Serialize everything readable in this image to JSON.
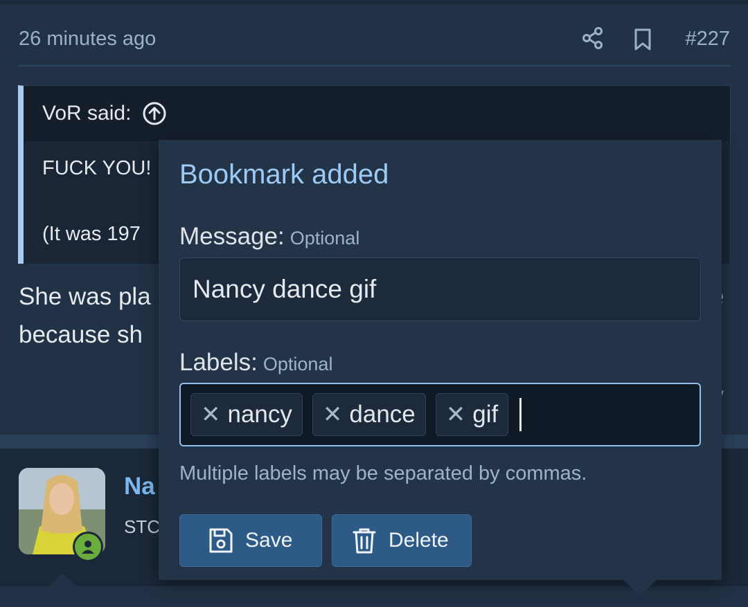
{
  "post": {
    "timestamp": "26 minutes ago",
    "post_number": "#227",
    "quote": {
      "author_line": "VoR said:",
      "line1": "FUCK YOU!",
      "line2": "(It was 197"
    },
    "body_line1": "She was pla",
    "body_line2": "because sh",
    "body_right1": "e",
    "body_right2": "y"
  },
  "next_post": {
    "username": "Na",
    "user_title": "STC"
  },
  "popup": {
    "title": "Bookmark added",
    "message_label": "Message:",
    "message_hint": "Optional",
    "message_value": "Nancy dance gif",
    "labels_label": "Labels:",
    "labels_hint": "Optional",
    "tags": [
      "nancy",
      "dance",
      "gif"
    ],
    "tag_remove_glyph": "✕",
    "help_text": "Multiple labels may be separated by commas.",
    "save_label": "Save",
    "delete_label": "Delete"
  },
  "icons": {
    "share": "share-icon",
    "bookmark": "bookmark-icon",
    "quote_jump": "arrow-up-circle-icon",
    "save": "floppy-disk-icon",
    "delete": "trash-icon",
    "online": "user-online-icon"
  },
  "colors": {
    "accent_title": "#9dcaf4",
    "username": "#7cb8ef",
    "button": "#2d5a87",
    "online_badge": "#6aad3c"
  }
}
